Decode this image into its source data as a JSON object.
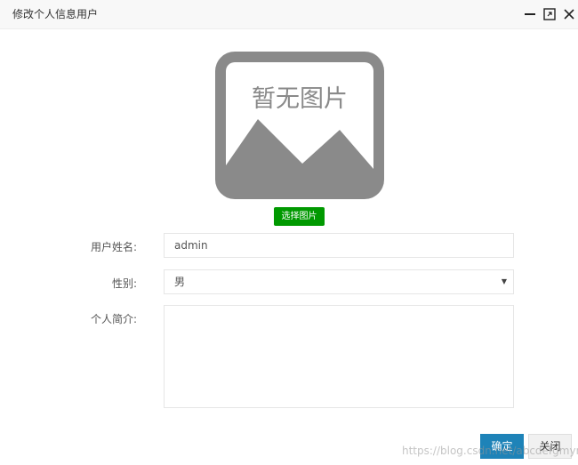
{
  "window": {
    "title": "修改个人信息用户",
    "controls": [
      "minimize-icon",
      "maximize-icon",
      "close-icon"
    ]
  },
  "avatar": {
    "placeholder_text": "暂无图片",
    "pick_button_label": "选择图片"
  },
  "form": {
    "username": {
      "label": "用户姓名:",
      "value": "admin"
    },
    "gender": {
      "label": "性别:",
      "selected": "男"
    },
    "bio": {
      "label": "个人简介:",
      "value": ""
    }
  },
  "footer": {
    "ok_label": "确定",
    "close_label": "关闭"
  },
  "watermark": "https://blog.csdn.net/abcdefgmyn",
  "colors": {
    "pick_button": "#009900",
    "ok_button": "#1e83b8",
    "placeholder_gray": "#8a8a8a"
  }
}
